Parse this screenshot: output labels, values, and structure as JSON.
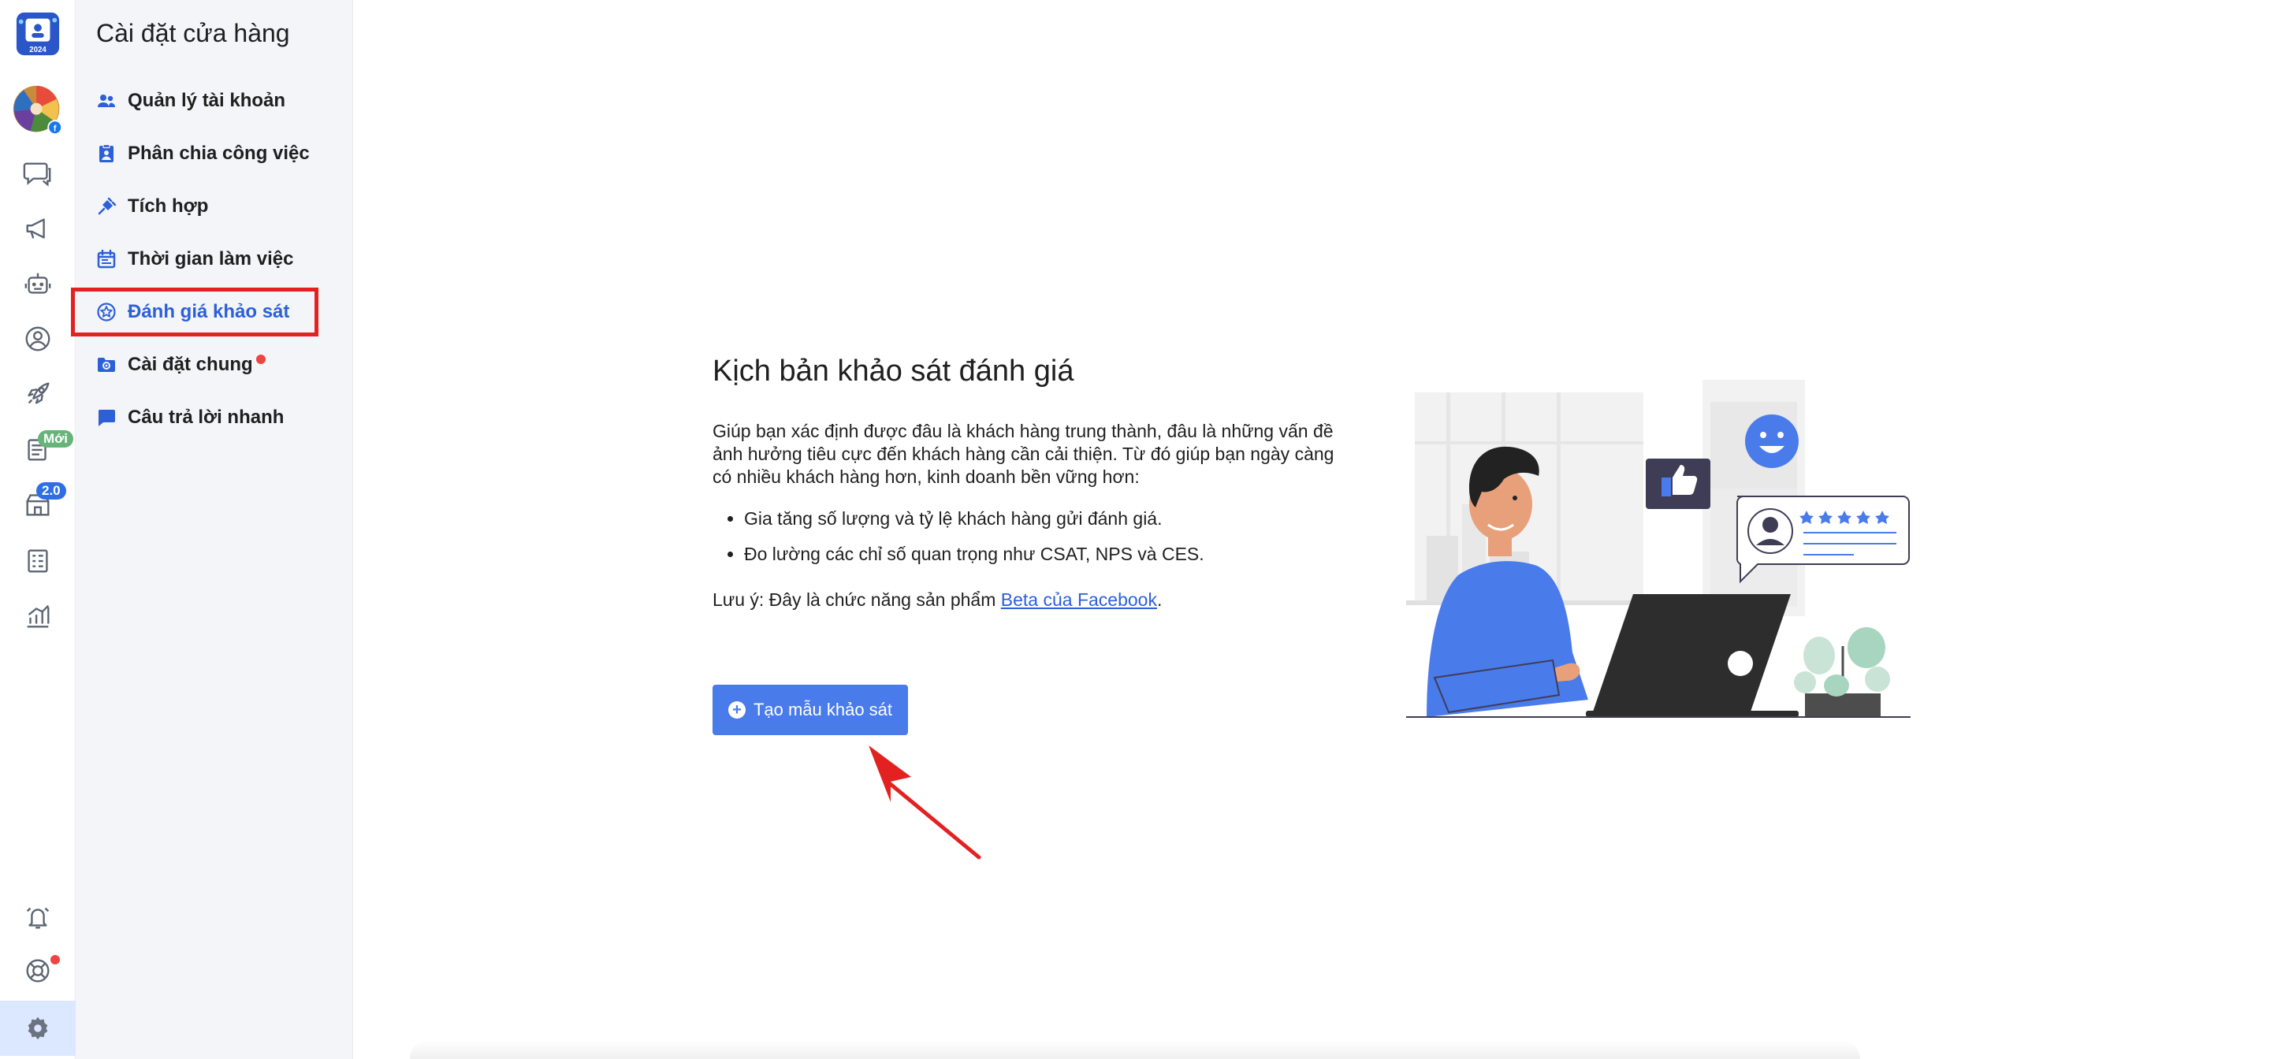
{
  "rail": {
    "logo_year": "2024",
    "badge_new": "Mới",
    "badge_version": "2.0"
  },
  "sidebar": {
    "title": "Cài đặt cửa hàng",
    "items": [
      {
        "label": "Quản lý tài khoản",
        "icon": "users-icon"
      },
      {
        "label": "Phân chia công việc",
        "icon": "assignment-icon"
      },
      {
        "label": "Tích hợp",
        "icon": "plug-icon"
      },
      {
        "label": "Thời gian làm việc",
        "icon": "calendar-icon"
      },
      {
        "label": "Đánh giá khảo sát",
        "icon": "survey-icon",
        "active": true
      },
      {
        "label": "Cài đặt chung",
        "icon": "settings-folder-icon",
        "dot": true
      },
      {
        "label": "Câu trả lời nhanh",
        "icon": "chat-bubble-icon"
      }
    ]
  },
  "main": {
    "title": "Kịch bản khảo sát đánh giá",
    "description": "Giúp bạn xác định được đâu là khách hàng trung thành, đâu là những vấn đề ảnh hưởng tiêu cực đến khách hàng cần cải thiện. Từ đó giúp bạn ngày càng có nhiều khách hàng hơn, kinh doanh bền vững hơn:",
    "bullets": [
      "Gia tăng số lượng và tỷ lệ khách hàng gửi đánh giá.",
      "Đo lường các chỉ số quan trọng như CSAT, NPS và CES."
    ],
    "note_prefix": "Lưu ý: Đây là chức năng sản phẩm ",
    "note_link": "Beta của Facebook",
    "note_suffix": ".",
    "create_button": "Tạo mẫu khảo sát"
  },
  "colors": {
    "accent": "#4a7bea",
    "active_text": "#2d5fd8",
    "highlight": "#e32121",
    "sidebar_bg": "#f3f5f8"
  }
}
